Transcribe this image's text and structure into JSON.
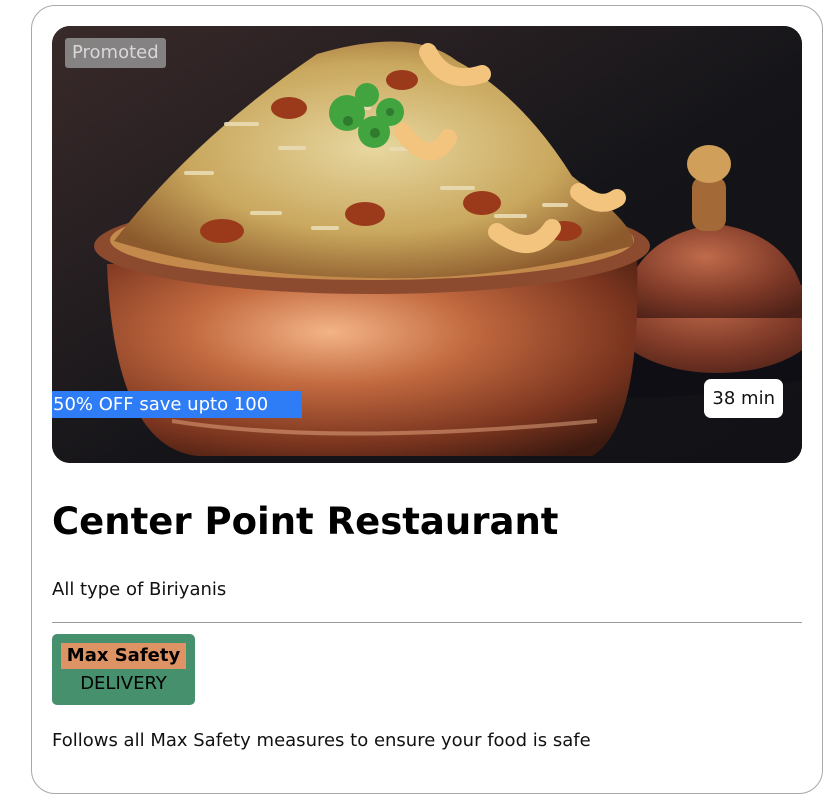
{
  "card": {
    "promoted_label": "Promoted",
    "offer_text": "50% OFF save upto 100",
    "delivery_time": "38 min",
    "restaurant_name": "Center Point Restaurant",
    "cuisine": "All type of Biriyanis",
    "safety_badge": {
      "title": "Max Safety",
      "subtitle": "DELIVERY"
    },
    "safety_description": "Follows all Max Safety measures to ensure your food is safe"
  },
  "colors": {
    "offer_banner": "#2f7df6",
    "badge_background": "#46906d",
    "badge_title_background": "#de9365",
    "card_border": "#a8a8a8"
  },
  "icons": {
    "hero_image": "biryani-bowl-photo"
  }
}
